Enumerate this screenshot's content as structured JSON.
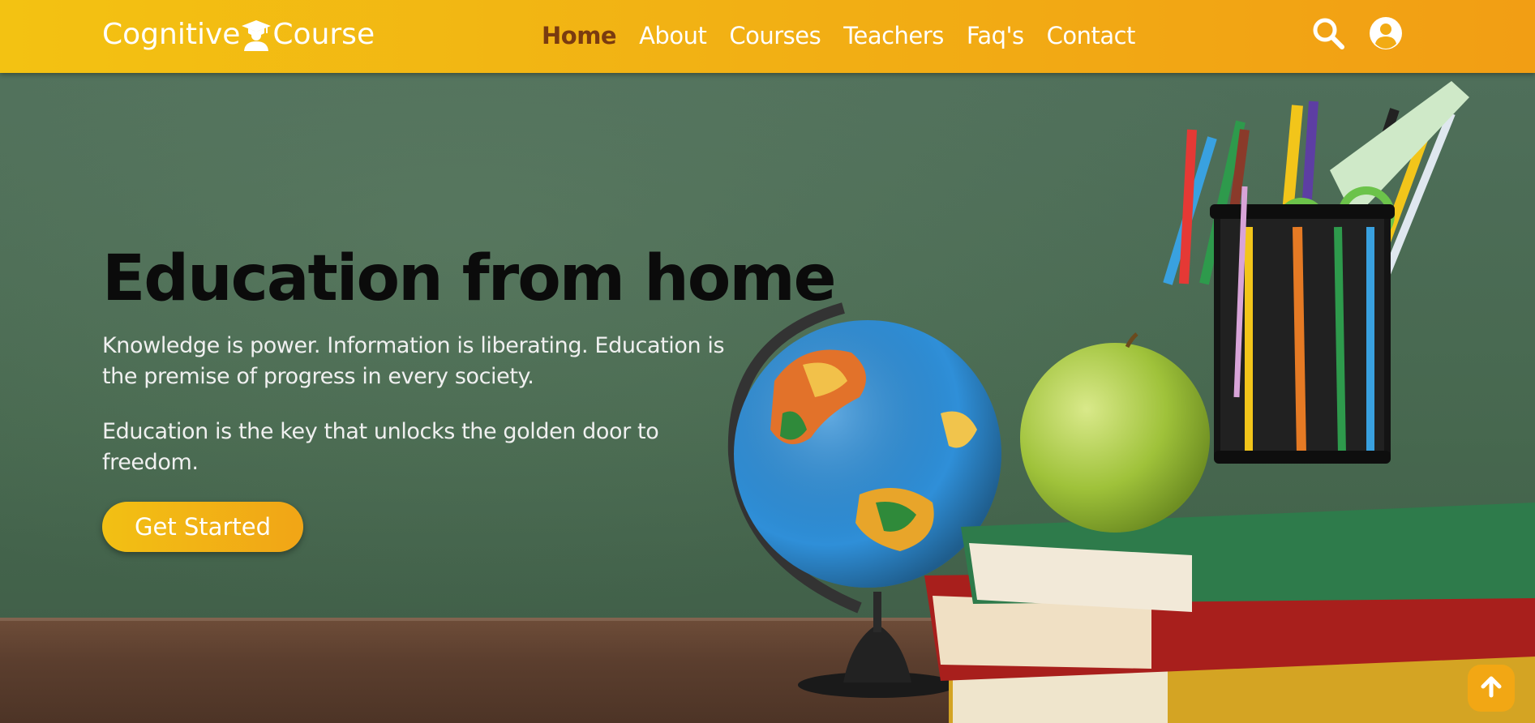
{
  "header": {
    "logo": {
      "part1": "Cognitive",
      "part2": "Course",
      "icon": "graduate-icon"
    },
    "nav": [
      {
        "label": "Home",
        "active": true
      },
      {
        "label": "About",
        "active": false
      },
      {
        "label": "Courses",
        "active": false
      },
      {
        "label": "Teachers",
        "active": false
      },
      {
        "label": "Faq's",
        "active": false
      },
      {
        "label": "Contact",
        "active": false
      }
    ],
    "icons": [
      "search-icon",
      "user-icon"
    ]
  },
  "hero": {
    "title": "Education from home",
    "paragraph1": "Knowledge is power. Information is liberating. Education is the premise of progress in every society.",
    "paragraph2": "Education is the key that unlocks the golden door to freedom.",
    "cta_label": "Get Started",
    "scene_items": [
      "globe",
      "green-apple",
      "pencil-cup",
      "book-stack"
    ]
  },
  "scroll_top_icon": "arrow-up-icon",
  "colors": {
    "header_start": "#f3c212",
    "header_end": "#f29e14",
    "active_nav": "#7a3b10",
    "chalkboard": "#4a6b52",
    "accent": "#f2a714"
  }
}
